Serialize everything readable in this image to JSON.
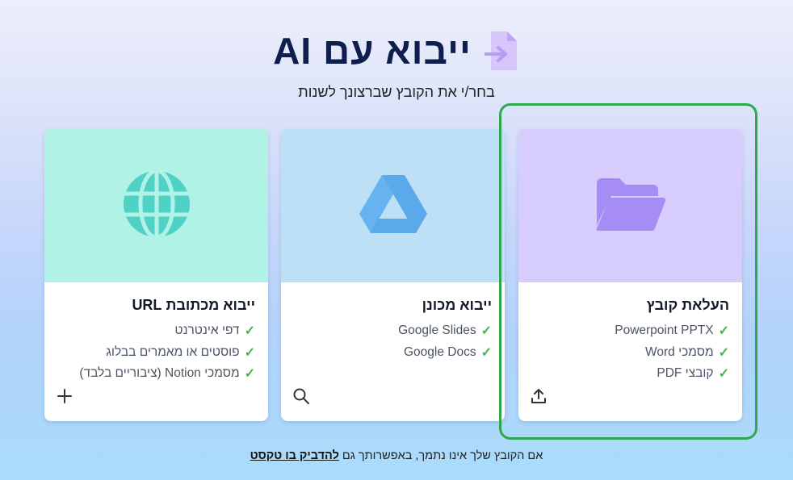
{
  "header": {
    "title": "ייבוא עם AI",
    "subtitle": "בחר/י את הקובץ שברצונך לשנות"
  },
  "cards": [
    {
      "title": "העלאת קובץ",
      "features": [
        "Powerpoint PPTX",
        "מסמכי Word",
        "קובצי PDF"
      ],
      "icon": "folder-icon",
      "action_icon": "upload-icon",
      "color": "#d7cdfd"
    },
    {
      "title": "ייבוא מכונן",
      "features": [
        "Google Slides",
        "Google Docs"
      ],
      "icon": "google-drive-icon",
      "action_icon": "search-icon",
      "color": "#bde0f7"
    },
    {
      "title": "ייבוא מכתובת URL",
      "features": [
        "דפי אינטרנט",
        "פוסטים או מאמרים בבלוג",
        "מסמכי Notion (ציבוריים בלבד)"
      ],
      "icon": "globe-icon",
      "action_icon": "plus-icon",
      "color": "#b1f2e6"
    }
  ],
  "footer": {
    "text": "אם הקובץ שלך אינו נתמך, באפשרותך גם",
    "link": "להדביק בו טקסט"
  },
  "colors": {
    "check": "#4caf50",
    "highlight": "#2ea84c",
    "title": "#0f1f4d"
  }
}
